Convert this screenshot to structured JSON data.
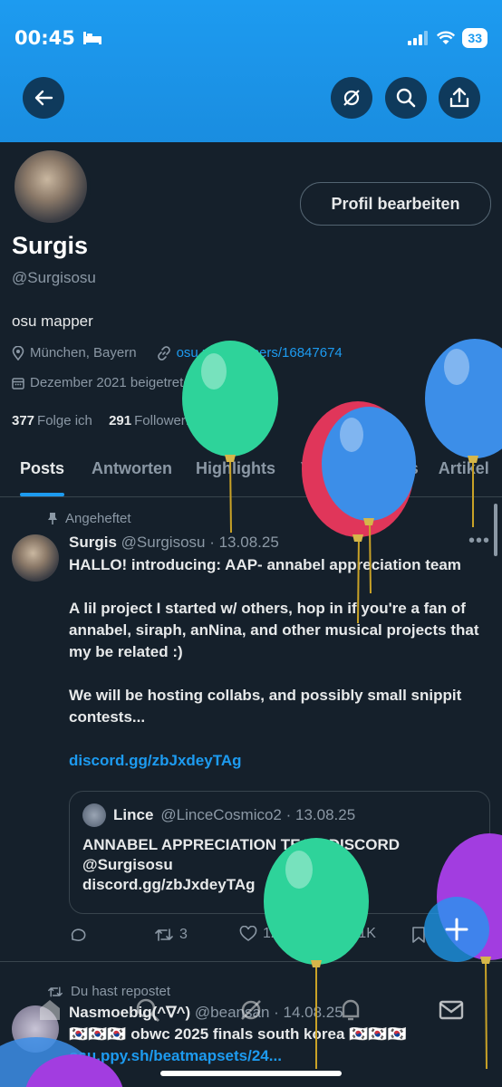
{
  "status_bar": {
    "time": "00:45",
    "battery": "33"
  },
  "profile": {
    "edit_button": "Profil bearbeiten",
    "name": "Surgis",
    "handle": "@Surgisosu",
    "bio": "osu mapper",
    "location": "München, Bayern",
    "link": "osu.ppy.sh/users/16847674",
    "joined": "Dezember 2021 beigetreten",
    "following_count": "377",
    "following_label": "Folge ich",
    "followers_count": "291",
    "followers_label": "Follower:innen"
  },
  "tabs": [
    "Posts",
    "Antworten",
    "Highlights",
    "Videos",
    "Fotos",
    "Artikel"
  ],
  "pinned_post": {
    "pinned_label": "Angeheftet",
    "author": "Surgis",
    "meta": "@Surgisosu · 13.08.25",
    "line1": "HALLO! introducing: AAP- annabel appreciation team",
    "line2": "A lil project I started w/ others, hop in if you're a fan of annabel, siraph, anNina, and other musical projects that my be related :)",
    "line3": "We will be hosting collabs, and possibly small snippit contests...",
    "link": "discord.gg/zbJxdeyTAg",
    "quote": {
      "author": "Lince",
      "meta": "@LinceCosmico2 · 13.08.25",
      "line1": "ANNABEL APPRECIATION TEAM DISCORD",
      "line2": "@Surgisosu",
      "line3": "discord.gg/zbJxdeyTAg"
    },
    "reposts": "3",
    "likes": "12",
    "views": "1,1K"
  },
  "second_post": {
    "repost_label": "Du hast repostet",
    "author": "Nasmoebig(^∇^)",
    "meta": "@beansan · 14.08.25",
    "text": "🇰🇷🇰🇷🇰🇷 obwc 2025 finals south korea 🇰🇷🇰🇷🇰🇷",
    "link": "osu.ppy.sh/beatmapsets/24..."
  },
  "colors": {
    "accent": "#1d9bf0",
    "background": "#15202b",
    "balloon_green": "#2ed39a",
    "balloon_blue": "#3c8ee8",
    "balloon_red": "#e0365a",
    "balloon_purple": "#a23de0"
  }
}
